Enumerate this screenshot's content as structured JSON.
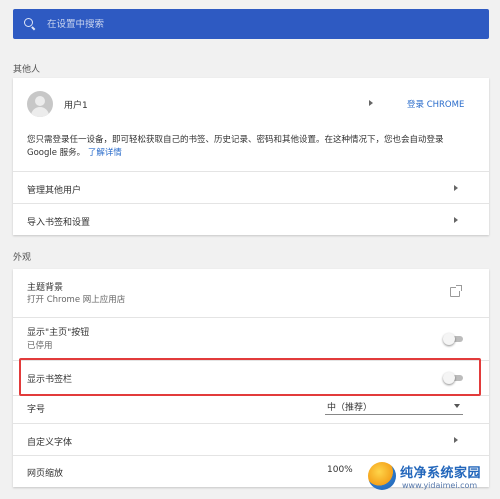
{
  "search": {
    "placeholder": "在设置中搜索"
  },
  "people": {
    "section_title": "其他人",
    "user_name": "用户1",
    "sign_in_label": "登录 CHROME",
    "sign_in_desc": "您只需登录任一设备，即可轻松获取自己的书签、历史记录、密码和其他设置。在这种情况下，您也会自动登录",
    "sign_in_desc2": "Google 服务。",
    "learn_more": "了解详情",
    "manage_others": "管理其他用户",
    "import_bookmarks": "导入书签和设置"
  },
  "appearance": {
    "section_title": "外观",
    "theme_label": "主题背景",
    "theme_sub": "打开 Chrome 网上应用店",
    "home_button_label": "显示\"主页\"按钮",
    "home_button_sub": "已停用",
    "home_button_enabled": false,
    "bookmarks_bar_label": "显示书签栏",
    "bookmarks_bar_enabled": false,
    "font_size_label": "字号",
    "font_size_value": "中（推荐）",
    "custom_fonts_label": "自定义字体",
    "zoom_label": "网页缩放",
    "zoom_value": "100%"
  },
  "watermark": {
    "title": "纯净系统家园",
    "url": "www.yidaimei.com"
  },
  "colors": {
    "accent": "#2e5ac2",
    "link": "#2a6ccb",
    "highlight": "#e23b3b"
  }
}
